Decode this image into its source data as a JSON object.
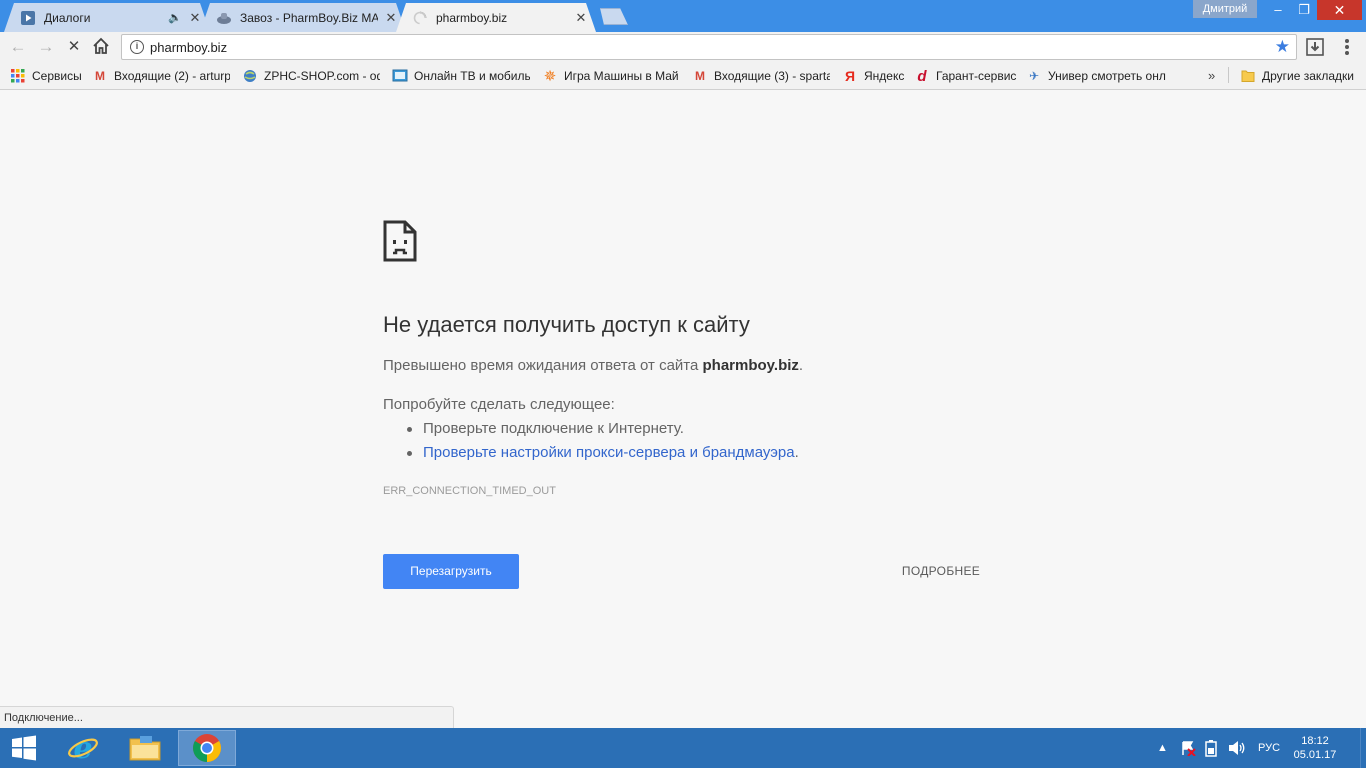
{
  "browser": {
    "tabs": [
      {
        "label": "Диалоги",
        "icon": "vk-icon",
        "sound": "🔈",
        "active": false
      },
      {
        "label": "Завоз - PharmBoy.Biz МА",
        "icon": "forum-icon",
        "active": false
      },
      {
        "label": "pharmboy.biz",
        "icon": "loading-spinner-icon",
        "active": true
      }
    ],
    "close_glyph": "✕",
    "user_name": "Дмитрий",
    "window_controls": {
      "minimize": "–",
      "maximize": "❐",
      "close": "✕"
    },
    "nav": {
      "back": "←",
      "forward": "→",
      "stop": "✕",
      "home": "⌂"
    },
    "address_bar": {
      "info": "i",
      "url": "pharmboy.biz",
      "star": "★"
    },
    "bookmarks": [
      {
        "label": "Сервисы",
        "icon": "apps-icon"
      },
      {
        "label": "Входящие (2) - arturp",
        "icon": "gmail-icon"
      },
      {
        "label": "ZPHC-SHOP.com - оф",
        "icon": "globe-icon"
      },
      {
        "label": "Онлайн ТВ и мобильн",
        "icon": "tv-icon"
      },
      {
        "label": "Игра Машины в Май",
        "icon": "game-icon"
      },
      {
        "label": "Входящие (3) - sparta",
        "icon": "gmail-icon"
      },
      {
        "label": "Яндекс",
        "icon": "yandex-icon"
      },
      {
        "label": "Гарант-сервис",
        "icon": "garant-icon"
      },
      {
        "label": "Универ смотреть онл",
        "icon": "plane-icon"
      }
    ],
    "bookmarks_more": "»",
    "other_bookmarks": "Другие закладки"
  },
  "error_page": {
    "title": "Не удается получить доступ к сайту",
    "desc_prefix": "Превышено время ожидания ответа от сайта ",
    "desc_host": "pharmboy.biz",
    "desc_suffix": ".",
    "try_heading": "Попробуйте сделать следующее:",
    "suggestions": [
      {
        "text": "Проверьте подключение к Интернету.",
        "link": false
      },
      {
        "text": "Проверьте настройки прокси-сервера и брандмауэра",
        "link": true,
        "suffix": "."
      }
    ],
    "error_code": "ERR_CONNECTION_TIMED_OUT",
    "reload_label": "Перезагрузить",
    "details_label": "ПОДРОБНЕЕ"
  },
  "status_bar": "Подключение...",
  "taskbar": {
    "apps": [
      {
        "name": "internet-explorer-icon"
      },
      {
        "name": "file-explorer-icon"
      },
      {
        "name": "chrome-icon",
        "active": true
      }
    ],
    "tray_arrow": "▲",
    "language": "РУС",
    "time": "18:12",
    "date": "05.01.17"
  },
  "colors": {
    "titlebar": "#3c8ee6",
    "taskbar": "#2b6fb5",
    "reload_button": "#4285f4",
    "link": "#3366cc"
  }
}
